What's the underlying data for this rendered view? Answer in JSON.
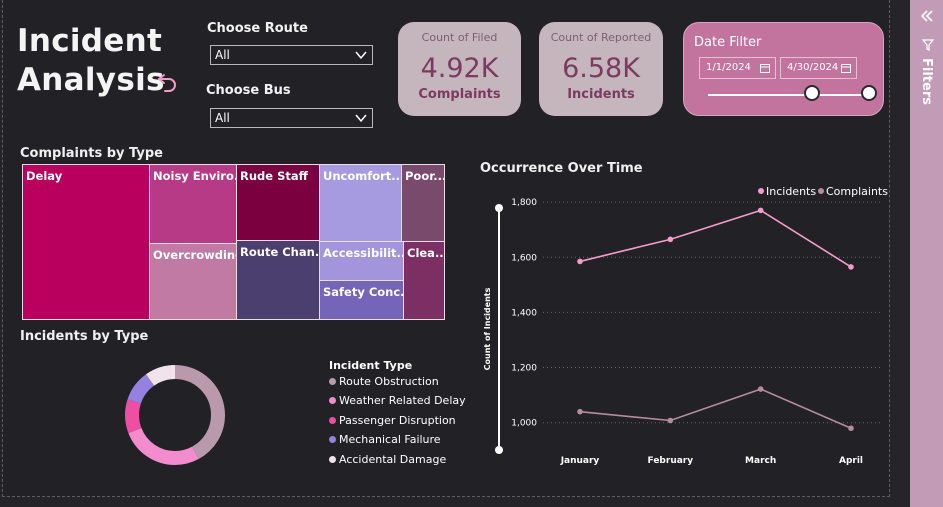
{
  "title_line1": "Incident",
  "title_line2": "Analysis",
  "route_slicer": {
    "label": "Choose Route",
    "value": "All"
  },
  "bus_slicer": {
    "label": "Choose Bus",
    "value": "All"
  },
  "cards": [
    {
      "label": "Count of Filed",
      "value": "4.92K",
      "sub": "Complaints"
    },
    {
      "label": "Count of Reported",
      "value": "6.58K",
      "sub": "Incidents"
    }
  ],
  "date_filter": {
    "label": "Date Filter",
    "start": "1/1/2024",
    "end": "4/30/2024"
  },
  "treemap": {
    "title": "Complaints by Type",
    "cells": [
      "Delay",
      "Noisy Enviro...",
      "Overcrowding",
      "Rude Staff",
      "Route Chan...",
      "Uncomfort...",
      "Accessibilit...",
      "Safety Conc...",
      "Poor...",
      "Clea..."
    ]
  },
  "donut": {
    "title": "Incidents by Type",
    "legend_title": "Incident Type",
    "items": [
      {
        "name": "Route Obstruction",
        "color": "#b89aac",
        "share": 0.42
      },
      {
        "name": "Weather Related Delay",
        "color": "#f28ccd",
        "share": 0.27
      },
      {
        "name": "Passenger Disruption",
        "color": "#ee4fa3",
        "share": 0.11
      },
      {
        "name": "Mechanical Failure",
        "color": "#9582e0",
        "share": 0.1
      },
      {
        "name": "Accidental Damage",
        "color": "#f1e3e9",
        "share": 0.1
      }
    ]
  },
  "chart_data": {
    "type": "line",
    "title": "Occurrence Over Time",
    "categories": [
      "January",
      "February",
      "March",
      "April"
    ],
    "series": [
      {
        "name": "Incidents",
        "color": "#f59ccd",
        "values": [
          1585,
          1665,
          1770,
          1565
        ]
      },
      {
        "name": "Complaints",
        "color": "#b48c9e",
        "values": [
          1040,
          1008,
          1122,
          980
        ]
      }
    ],
    "ylabel": "Count of Incidents",
    "yticks": [
      "1,000",
      "1,200",
      "1,400",
      "1,600",
      "1,800"
    ],
    "ylim": [
      930,
      1815
    ],
    "legend": "top-right",
    "grid": true
  },
  "filters_pane": {
    "label": "Filters"
  }
}
